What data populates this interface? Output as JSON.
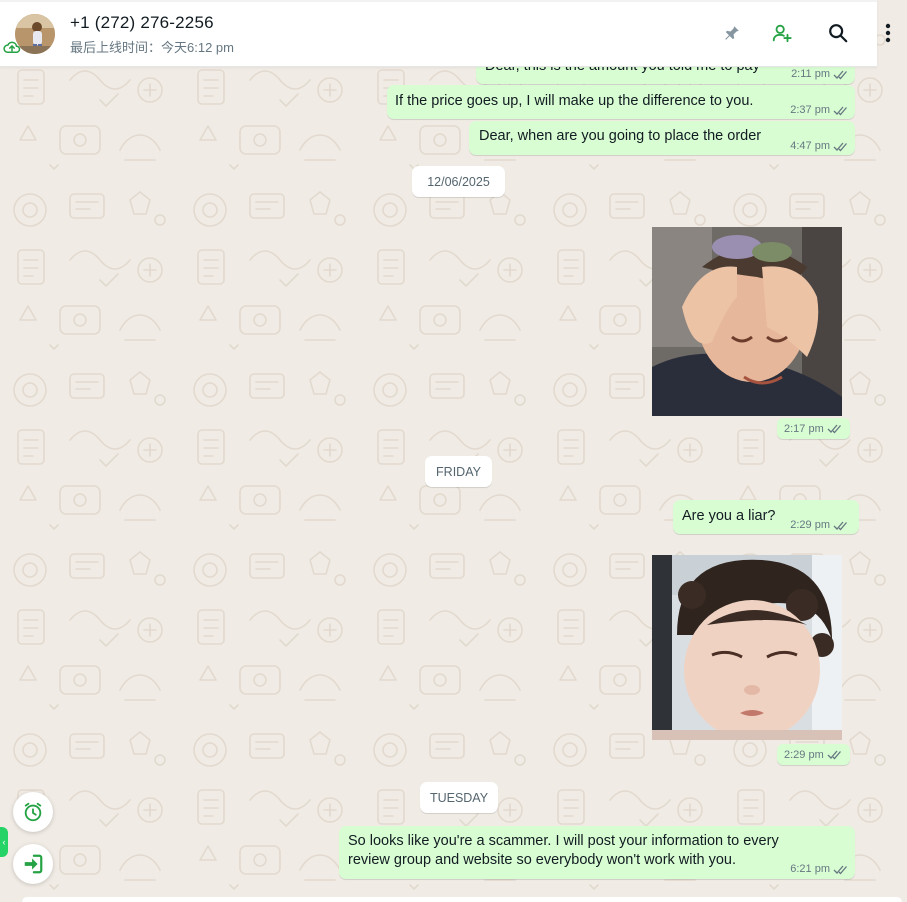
{
  "header": {
    "contact_name": "+1 (272) 276-2256",
    "last_seen": "最后上线时间：今天6:12 pm",
    "icons": [
      "pin-icon",
      "add-contact-icon",
      "search-icon",
      "menu-icon"
    ]
  },
  "messages": [
    {
      "text": "Dear, this is the amount you told me to pay",
      "time": "2:11 pm"
    },
    {
      "text": "If the price goes up, I will make up the difference to you.",
      "time": "2:37 pm"
    },
    {
      "text": "Dear, when are you going to place the order",
      "time": "4:47 pm"
    },
    {
      "date": "12/06/2025"
    },
    {
      "image": "child-hands-on-head-photo",
      "time": "2:17 pm"
    },
    {
      "date": "FRIDAY"
    },
    {
      "text": "Are you a liar?",
      "time": "2:29 pm"
    },
    {
      "image": "toddler-face-photo",
      "time": "2:29 pm"
    },
    {
      "date": "TUESDAY"
    },
    {
      "text_line1": "So looks like you're a scammer. I will post your information to every",
      "text_line2": "review group and website so everybody won't work with you.",
      "time": "6:21 pm"
    }
  ],
  "floating": {
    "icons": [
      "alarm-clock-icon",
      "login-icon",
      "side-tab-chevron-icon"
    ]
  },
  "colors": {
    "outgoing_bubble": "#d9fdd3",
    "accent_green": "#25d366",
    "tick_color": "#667781",
    "chat_bg": "#f0ebe4"
  }
}
